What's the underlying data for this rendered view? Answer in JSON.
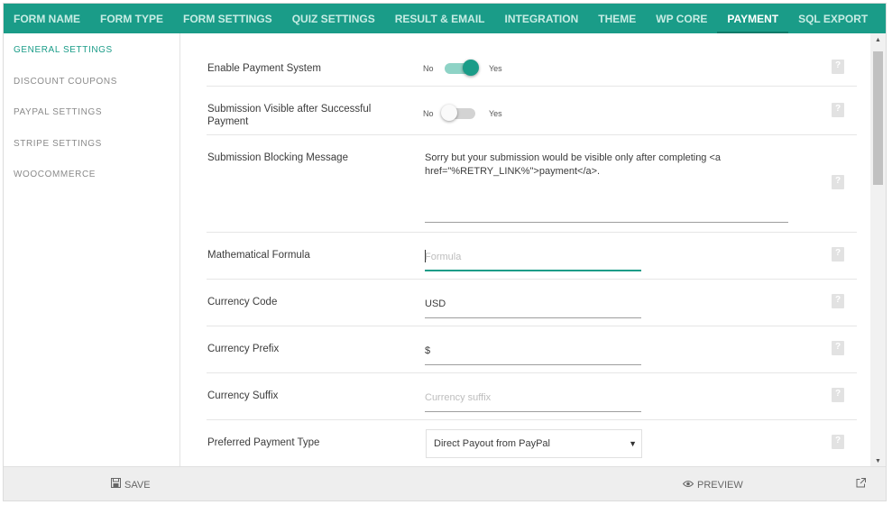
{
  "topnav": {
    "tabs": [
      {
        "label": "FORM NAME"
      },
      {
        "label": "FORM TYPE"
      },
      {
        "label": "FORM SETTINGS"
      },
      {
        "label": "QUIZ SETTINGS"
      },
      {
        "label": "RESULT & EMAIL"
      },
      {
        "label": "INTEGRATION"
      },
      {
        "label": "THEME"
      },
      {
        "label": "WP CORE"
      },
      {
        "label": "PAYMENT"
      },
      {
        "label": "SQL EXPORT"
      }
    ],
    "active": "PAYMENT"
  },
  "sidebar": {
    "items": [
      {
        "label": "GENERAL SETTINGS"
      },
      {
        "label": "DISCOUNT COUPONS"
      },
      {
        "label": "PAYPAL SETTINGS"
      },
      {
        "label": "STRIPE SETTINGS"
      },
      {
        "label": "WOOCOMMERCE"
      }
    ],
    "active": "GENERAL SETTINGS"
  },
  "settings": {
    "enable_payment": {
      "label": "Enable Payment System",
      "no": "No",
      "yes": "Yes",
      "value": true
    },
    "submission_visible": {
      "label": "Submission Visible after Successful Payment",
      "no": "No",
      "yes": "Yes",
      "value": false
    },
    "blocking_message": {
      "label": "Submission Blocking Message",
      "value": "Sorry but your submission would be visible only after completing <a href=\"%RETRY_LINK%\">payment</a>."
    },
    "formula": {
      "label": "Mathematical Formula",
      "placeholder": "Formula",
      "value": ""
    },
    "currency_code": {
      "label": "Currency Code",
      "value": "USD"
    },
    "currency_prefix": {
      "label": "Currency Prefix",
      "value": "$"
    },
    "currency_suffix": {
      "label": "Currency Suffix",
      "placeholder": "Currency suffix",
      "value": ""
    },
    "payment_type": {
      "label": "Preferred Payment Type",
      "value": "Direct Payout from PayPal"
    }
  },
  "footer": {
    "save_label": "SAVE",
    "preview_label": "PREVIEW"
  },
  "colors": {
    "accent": "#1a9c88",
    "accent_light": "#8ed3c6"
  },
  "icons": {
    "save": "floppy-disk-icon",
    "preview": "eye-icon",
    "external": "external-link-icon",
    "help": "help-icon"
  }
}
